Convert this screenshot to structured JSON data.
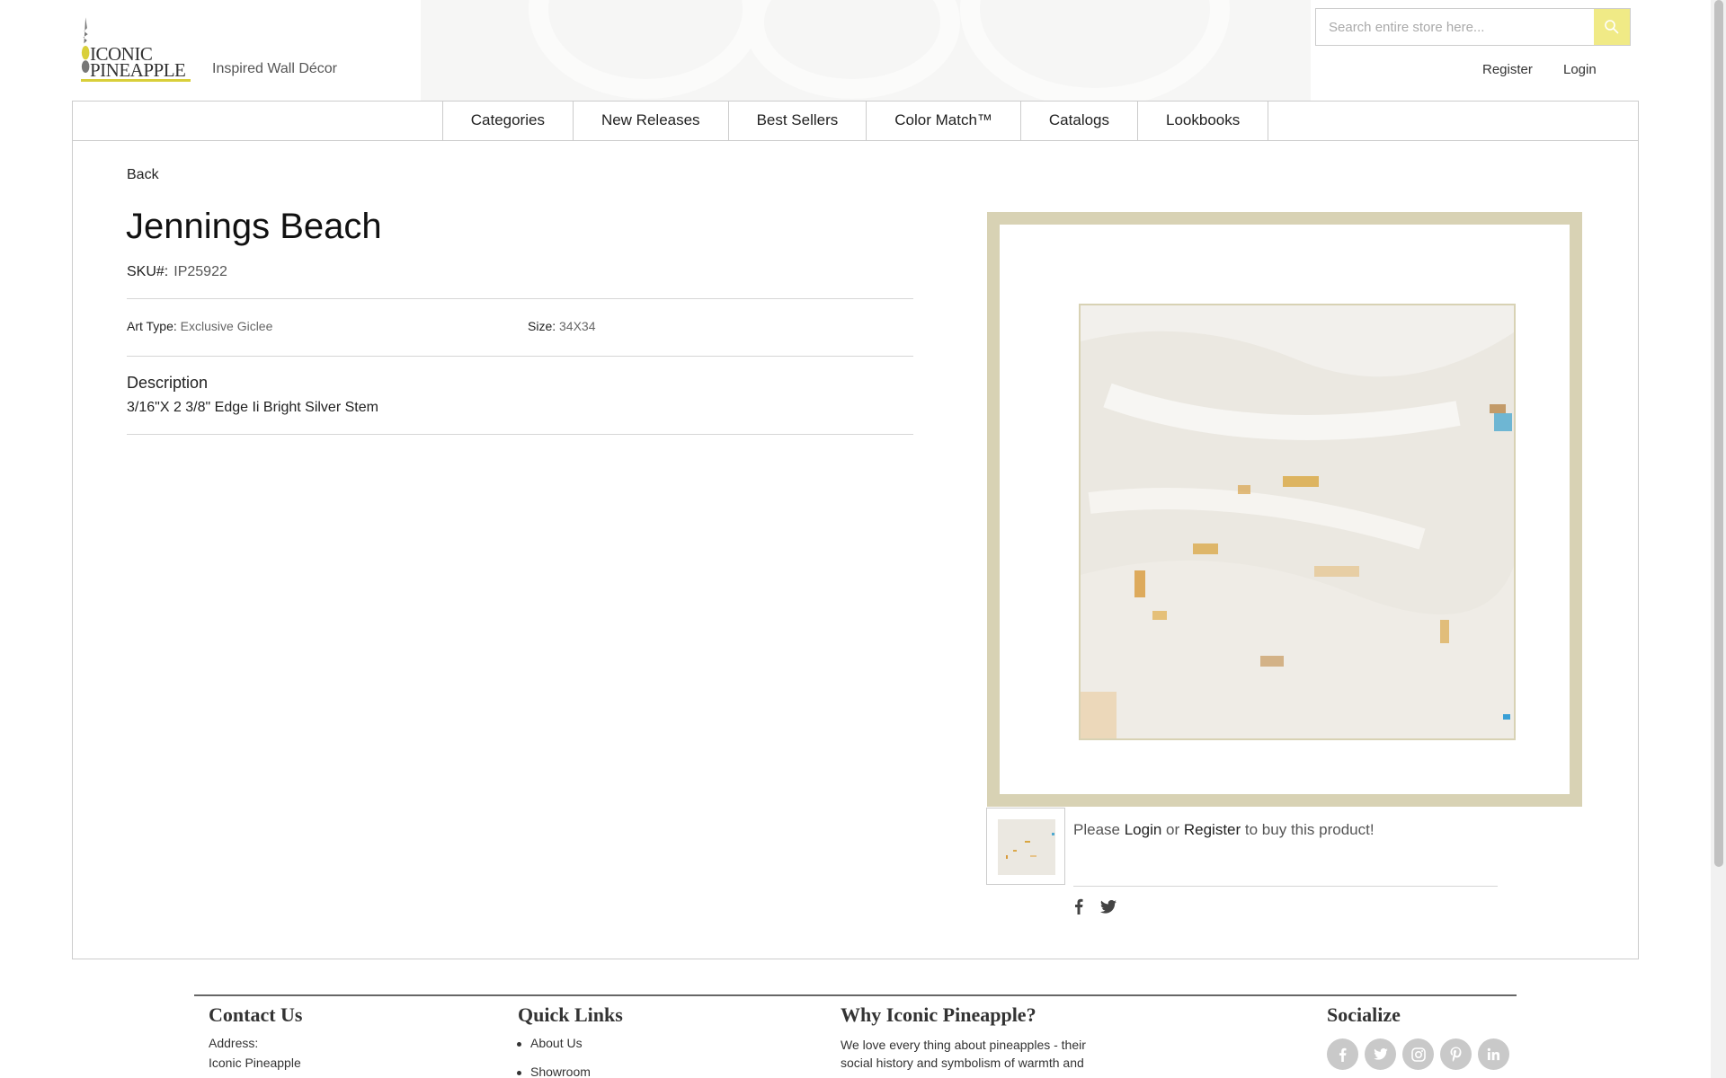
{
  "header": {
    "logo_line1": "ICONIC",
    "logo_line2": "PINEAPPLE",
    "tagline": "Inspired Wall Décor",
    "search_placeholder": "Search entire store here...",
    "register_label": "Register",
    "login_label": "Login",
    "brand_accent": "#f0ea86"
  },
  "nav": {
    "items": [
      "Categories",
      "New Releases",
      "Best Sellers",
      "Color Match™",
      "Catalogs",
      "Lookbooks"
    ]
  },
  "product": {
    "back_label": "Back",
    "title": "Jennings Beach",
    "sku_label": "SKU#:",
    "sku_value": "IP25922",
    "art_type_label": "Art Type:",
    "art_type_value": "Exclusive Giclee",
    "size_label": "Size:",
    "size_value": "34X34",
    "description_heading": "Description",
    "description_text": "3/16\"X 2 3/8\" Edge Ii Bright Silver Stem",
    "frame_color": "#d8d2b4"
  },
  "purchase": {
    "prefix": "Please ",
    "login_link": "Login",
    "middle": " or ",
    "register_link": "Register",
    "suffix": " to buy this product!"
  },
  "share": {
    "icons": [
      "facebook-icon",
      "twitter-icon"
    ]
  },
  "footer": {
    "contact_heading": "Contact Us",
    "address_label": "Address:",
    "address_line1": "Iconic Pineapple",
    "quicklinks_heading": "Quick Links",
    "quicklinks": [
      "About Us",
      "Showroom"
    ],
    "why_heading": "Why Iconic Pineapple?",
    "why_line1": "We love every thing about pineapples - their",
    "why_line2": "social history and symbolism of warmth and",
    "socialize_heading": "Socialize",
    "social_icons": [
      "facebook-icon",
      "twitter-icon",
      "instagram-icon",
      "pinterest-icon",
      "linkedin-icon"
    ]
  }
}
